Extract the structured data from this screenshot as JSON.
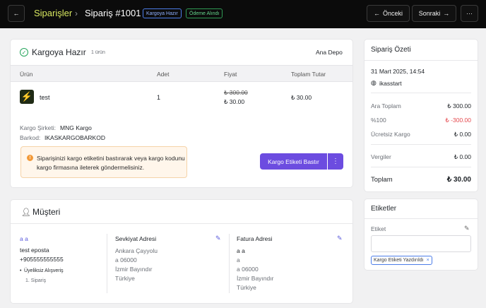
{
  "header": {
    "breadcrumb_parent": "Siparişler",
    "breadcrumb_separator": "›",
    "order_title": "Sipariş #1001",
    "status_tags": [
      "Kargoya Hazır",
      "Ödeme Alındı"
    ],
    "prev_label": "Önceki",
    "next_label": "Sonraki",
    "more_label": "···"
  },
  "fulfillment": {
    "title": "Kargoya Hazır",
    "count": "1 ürün",
    "warehouse": "Ana Depo",
    "columns": [
      "Ürün",
      "Adet",
      "Fiyat",
      "Toplam Tutar"
    ],
    "item": {
      "name": "test",
      "quantity": "1",
      "old_price": "₺ 300.00",
      "price": "₺ 30.00",
      "total": "₺ 30.00"
    },
    "carrier_label": "Kargo Şirketi:",
    "carrier_value": "MNG Kargo",
    "barcode_label": "Barkod:",
    "barcode_value": "IKASKARGOBARKOD",
    "warning": "Siparişinizi kargo etiketini bastırarak veya kargo kodunu kargo firmasına ileterek göndermelisiniz.",
    "print_button": "Kargo Etiketi Bastır",
    "print_more": "⋮"
  },
  "customer": {
    "title": "Müşteri",
    "name": "a a",
    "email": "test eposta",
    "phone": "+905555555555",
    "membership": "Üyeliksiz Alışveriş",
    "order_count": "1. Sipariş",
    "shipping": {
      "title": "Sevkiyat Adresi",
      "lines": [
        "Ankara Çayyolu",
        "a 06000",
        "İzmir Bayındır",
        "Türkiye"
      ]
    },
    "billing": {
      "title": "Fatura Adresi",
      "name": "a a",
      "lines": [
        "a",
        "a 06000",
        "İzmir Bayındır",
        "Türkiye"
      ]
    }
  },
  "summary": {
    "title": "Sipariş Özeti",
    "date": "31 Mart 2025, 14:54",
    "channel": "ikasstart",
    "rows": [
      {
        "label": "Ara Toplam",
        "value": "₺ 300.00"
      },
      {
        "label": "%100",
        "value": "₺ -300.00"
      },
      {
        "label": "Ücretsiz Kargo",
        "value": "₺ 0.00"
      },
      {
        "label": "Vergiler",
        "value": "₺ 0.00"
      }
    ],
    "total_label": "Toplam",
    "total_value": "₺ 30.00",
    "discount_color": "#e5484d"
  },
  "labels": {
    "title": "Etiketler",
    "field_label": "Etiket",
    "chip": "Kargo Etiketi Yazdırıldı",
    "chip_remove": "×"
  },
  "colors": {
    "accent": "#6c4ce0",
    "success": "#23a45a",
    "breadcrumb": "#d8e860"
  },
  "icons": {
    "back": "arrow-left-icon",
    "prev": "arrow-left-icon",
    "next": "arrow-right-icon",
    "status": "check-circle-icon",
    "globe": "globe-icon",
    "user": "user-icon",
    "edit": "edit-icon",
    "pencil": "pencil-icon",
    "warning": "warning-icon"
  }
}
